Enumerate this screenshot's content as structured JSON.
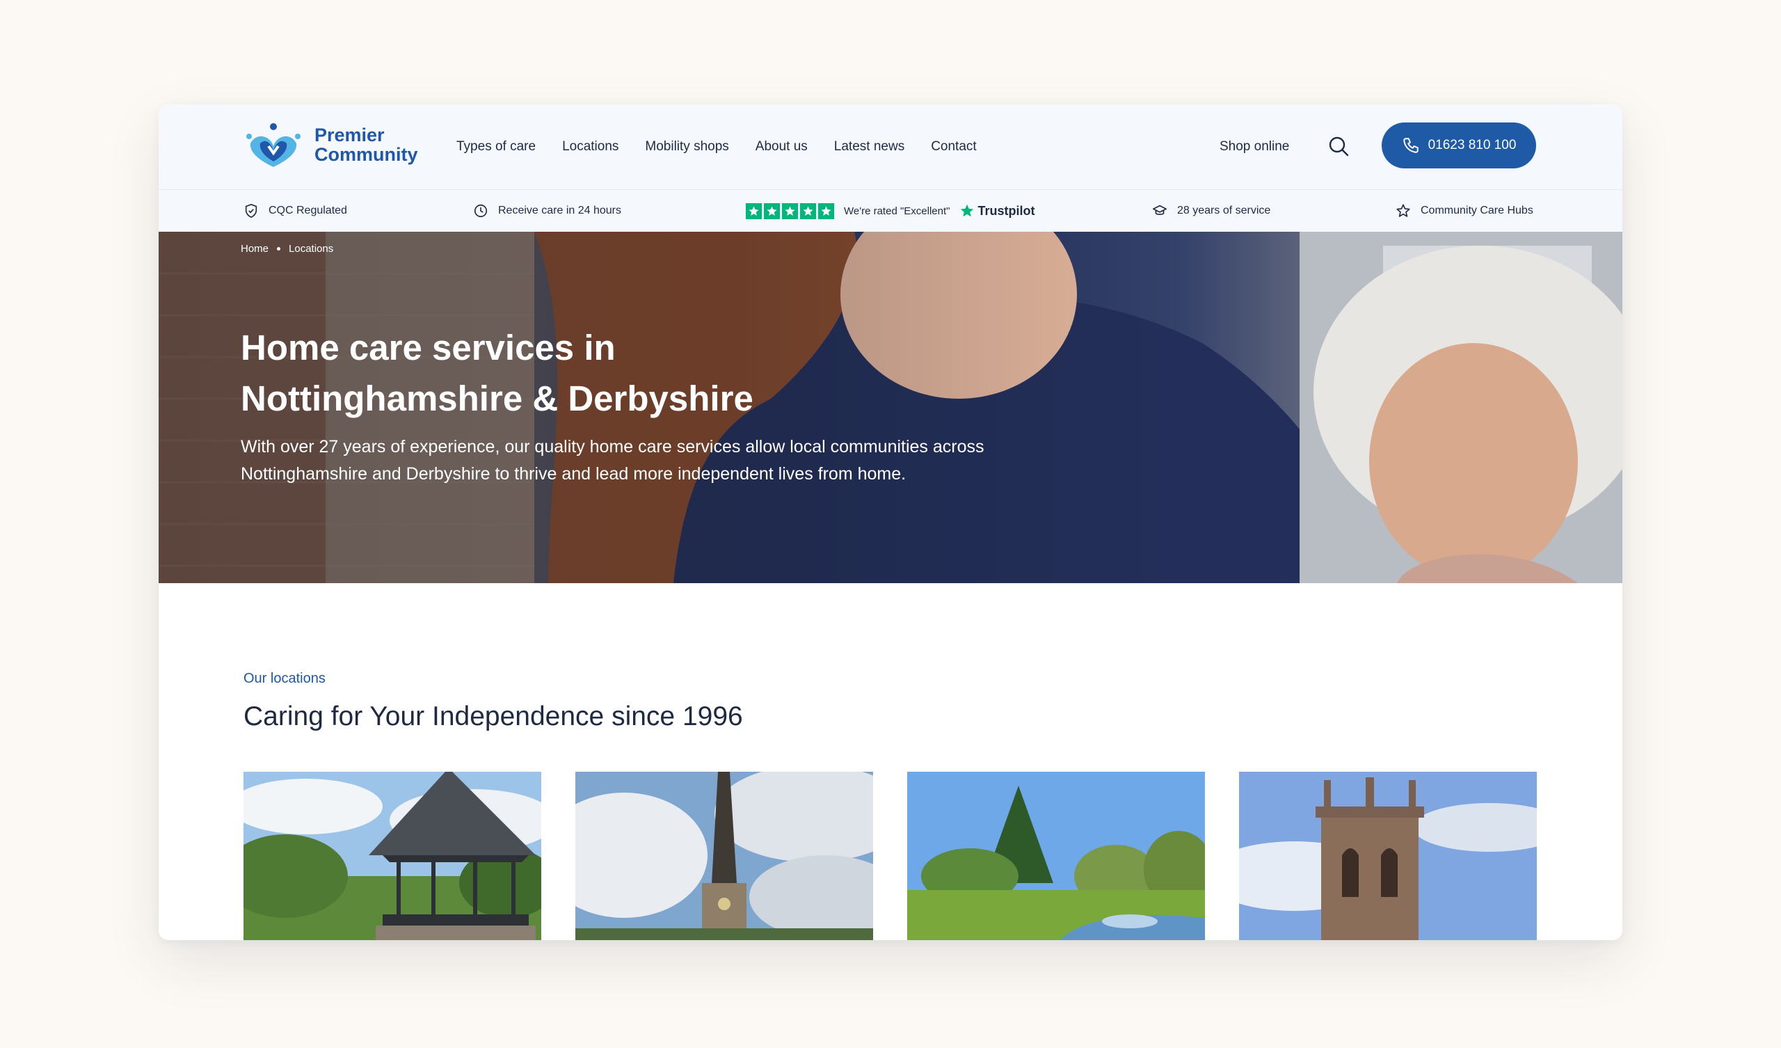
{
  "brand": {
    "line1": "Premier",
    "line2": "Community",
    "primary_color": "#1e5aa6",
    "accent_color": "#55b4e6"
  },
  "nav": {
    "items": [
      "Types of care",
      "Locations",
      "Mobility shops",
      "About us",
      "Latest news",
      "Contact"
    ],
    "shop_online": "Shop online",
    "phone": "01623 810 100"
  },
  "trust_bar": {
    "cqc": "CQC Regulated",
    "care_time": "Receive care in 24 hours",
    "rating_text": "We're rated \"Excellent\"",
    "trustpilot": "Trustpilot",
    "years": "28 years of service",
    "hubs": "Community Care Hubs",
    "trustpilot_color": "#00b67a"
  },
  "hero": {
    "breadcrumb": [
      "Home",
      "Locations"
    ],
    "title_line1": "Home care services in",
    "title_line2": "Nottinghamshire & Derbyshire",
    "subtitle_line1": "With over 27 years of experience, our quality home care services allow local communities across",
    "subtitle_line2": "Nottinghamshire and Derbyshire to thrive and lead more independent lives from home."
  },
  "locations": {
    "eyebrow": "Our locations",
    "title": "Caring for Your Independence since 1996"
  }
}
